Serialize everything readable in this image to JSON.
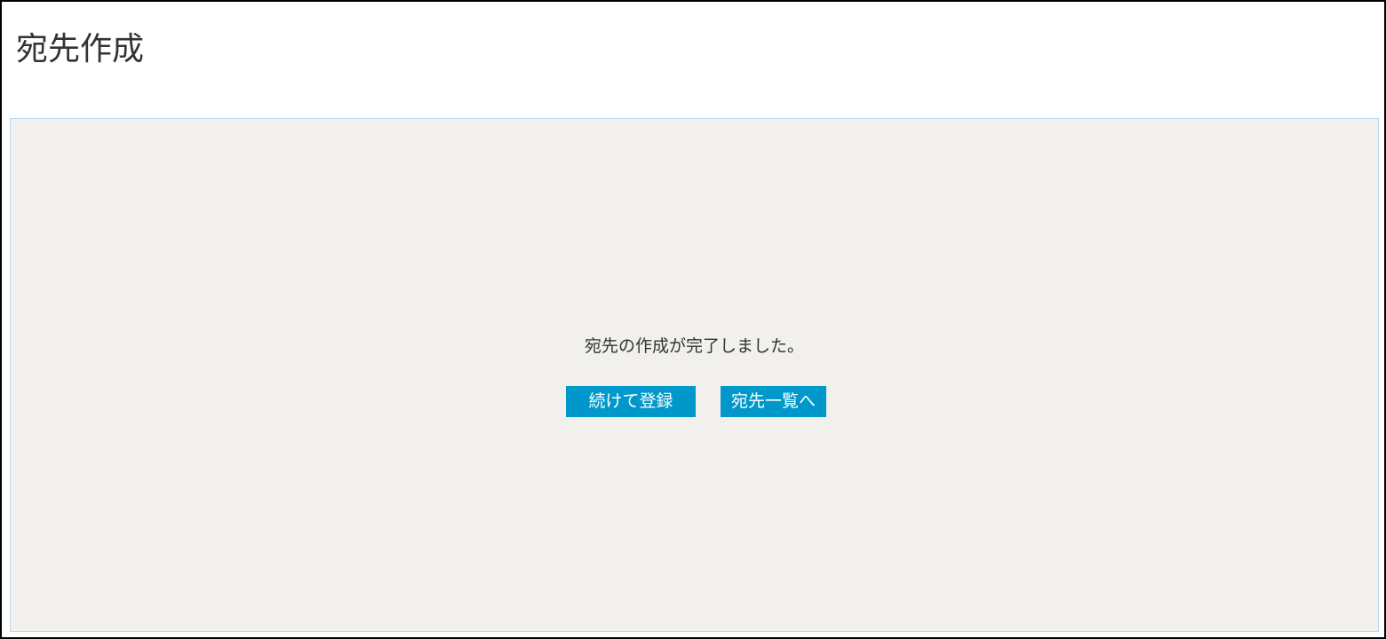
{
  "header": {
    "title": "宛先作成"
  },
  "main": {
    "message": "宛先の作成が完了しました。",
    "buttons": {
      "continue_label": "続けて登録",
      "list_label": "宛先一覧へ"
    }
  },
  "colors": {
    "button_background": "#0098cb",
    "panel_background": "#f2f0ec",
    "panel_border": "#b5d9f2"
  }
}
